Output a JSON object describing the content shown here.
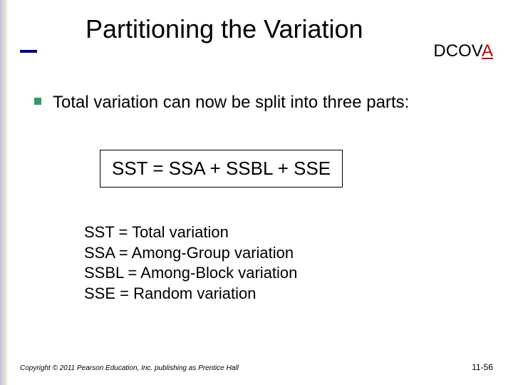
{
  "header": {
    "title": "Partitioning the Variation",
    "dcov": "DCOV",
    "a": "A"
  },
  "bullet": {
    "text": "Total variation can now be split into three parts:"
  },
  "formula": {
    "text": "SST = SSA + SSBL + SSE"
  },
  "definitions": {
    "line1": "SST = Total variation",
    "line2": "SSA = Among-Group variation",
    "line3": "SSBL = Among-Block variation",
    "line4": "SSE = Random variation"
  },
  "footer": {
    "copyright": "Copyright © 2011 Pearson Education, Inc. publishing as Prentice Hall",
    "slide_number": "11-56"
  }
}
